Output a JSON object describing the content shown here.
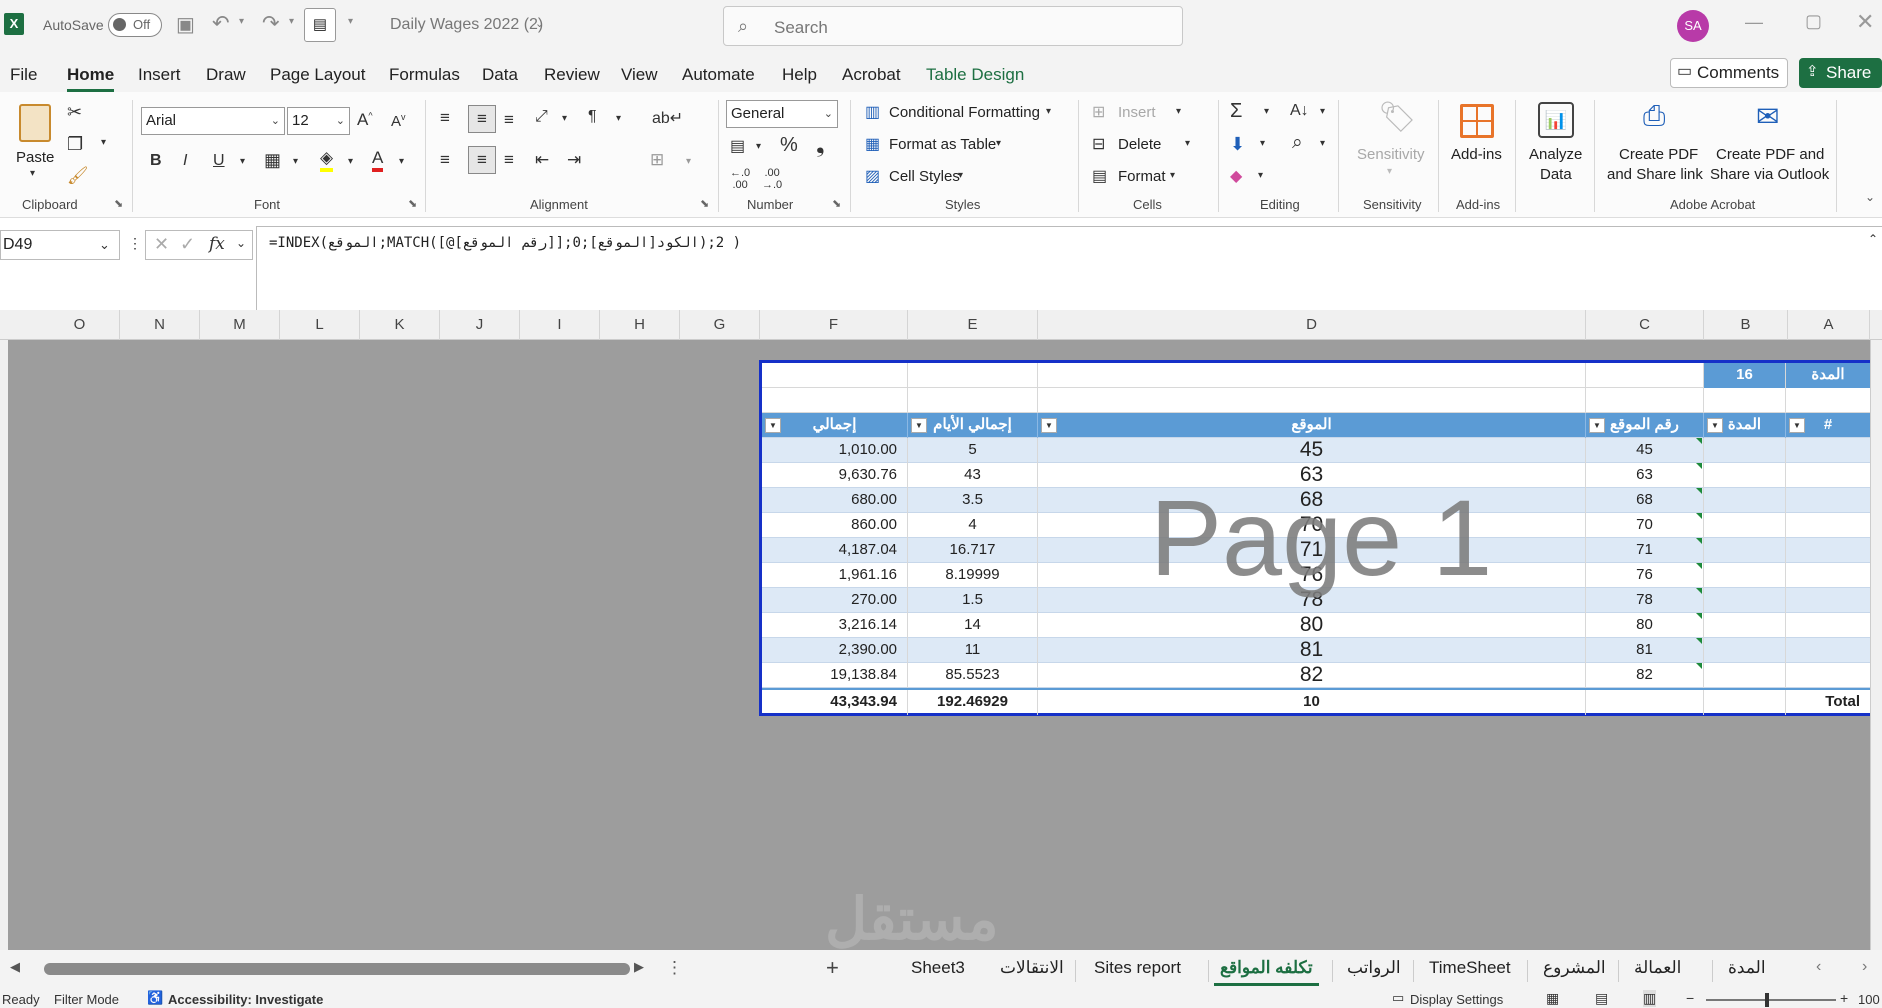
{
  "titlebar": {
    "autosave_label": "AutoSave",
    "autosave_state": "Off",
    "file_name": "Daily Wages 2022 (2)",
    "search_placeholder": "Search",
    "user_initials": "SA"
  },
  "menu": {
    "tabs": [
      "File",
      "Home",
      "Insert",
      "Draw",
      "Page Layout",
      "Formulas",
      "Data",
      "Review",
      "View",
      "Automate",
      "Help",
      "Acrobat",
      "Table Design"
    ],
    "active_tab": "Home",
    "comments_label": "Comments",
    "share_label": "Share"
  },
  "ribbon": {
    "clipboard": {
      "paste": "Paste",
      "label": "Clipboard"
    },
    "font": {
      "name": "Arial",
      "size": "12",
      "label": "Font"
    },
    "alignment": {
      "label": "Alignment"
    },
    "number": {
      "format": "General",
      "label": "Number"
    },
    "styles": {
      "conditional": "Conditional Formatting",
      "format_table": "Format as Table",
      "cell_styles": "Cell Styles",
      "label": "Styles"
    },
    "cells": {
      "insert": "Insert",
      "delete": "Delete",
      "format": "Format",
      "label": "Cells"
    },
    "editing": {
      "label": "Editing"
    },
    "sensitivity": {
      "button": "Sensitivity",
      "label": "Sensitivity"
    },
    "addins": {
      "button": "Add-ins",
      "label": "Add-ins"
    },
    "analyze": {
      "line1": "Analyze",
      "line2": "Data"
    },
    "acrobat": {
      "pdf_link_1": "Create PDF",
      "pdf_link_2": "and Share link",
      "pdf_outlook_1": "Create PDF and",
      "pdf_outlook_2": "Share via Outlook",
      "label": "Adobe Acrobat"
    }
  },
  "formula_bar": {
    "cell_ref": "D49",
    "formula": "=INDEX(الموقع;MATCH([@[رقم الموقع]];الكود[الموقع];0);2  )"
  },
  "columns": [
    "O",
    "N",
    "M",
    "L",
    "K",
    "J",
    "I",
    "H",
    "G",
    "F",
    "E",
    "D",
    "C",
    "B",
    "A"
  ],
  "table": {
    "duration_label": "المدة",
    "duration_value": "16",
    "headers": {
      "total": "إجمالي",
      "total_days": "إجمالي الأيام",
      "site": "الموقع",
      "site_no": "رقم الموقع",
      "duration": "المدة",
      "index": "#"
    },
    "rows": [
      {
        "total": "1,010.00",
        "days": "5",
        "site": "45",
        "site_no": "45"
      },
      {
        "total": "9,630.76",
        "days": "43",
        "site": "63",
        "site_no": "63"
      },
      {
        "total": "680.00",
        "days": "3.5",
        "site": "68",
        "site_no": "68"
      },
      {
        "total": "860.00",
        "days": "4",
        "site": "70",
        "site_no": "70"
      },
      {
        "total": "4,187.04",
        "days": "16.717",
        "site": "71",
        "site_no": "71"
      },
      {
        "total": "1,961.16",
        "days": "8.19999",
        "site": "76",
        "site_no": "76"
      },
      {
        "total": "270.00",
        "days": "1.5",
        "site": "78",
        "site_no": "78"
      },
      {
        "total": "3,216.14",
        "days": "14",
        "site": "80",
        "site_no": "80"
      },
      {
        "total": "2,390.00",
        "days": "11",
        "site": "81",
        "site_no": "81"
      },
      {
        "total": "19,138.84",
        "days": "85.5523",
        "site": "82",
        "site_no": "82"
      }
    ],
    "totals": {
      "total": "43,343.94",
      "days": "192.46929",
      "site": "10",
      "label": "Total"
    }
  },
  "watermarks": {
    "page": "Page 1",
    "site": "مستقل"
  },
  "sheets": [
    "Sheet3",
    "الانتقالات",
    "Sites report",
    "تكلفه المواقع",
    "الرواتب",
    "TimeSheet",
    "المشروع",
    "العمالة",
    "المدة"
  ],
  "active_sheet": "تكلفه المواقع",
  "status": {
    "ready": "Ready",
    "filter": "Filter Mode",
    "accessibility": "Accessibility: Investigate",
    "display": "Display Settings",
    "zoom": "100"
  },
  "colors": {
    "excel_green": "#1d6f42",
    "table_header": "#5b9bd5",
    "table_band": "#dde9f6",
    "table_border": "#1530c8"
  }
}
